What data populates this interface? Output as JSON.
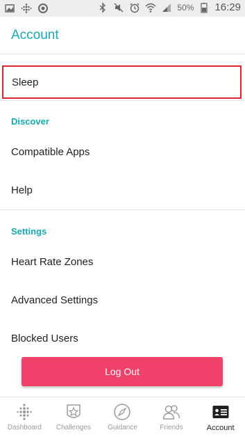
{
  "status_bar": {
    "battery_percent": "50%",
    "time": "16:29",
    "icons_left": [
      "image-icon",
      "fitbit-dots-icon",
      "sync-icon"
    ],
    "icons_right": [
      "bluetooth-icon",
      "mute-icon",
      "alarm-icon",
      "wifi-icon",
      "signal-icon",
      "battery-icon"
    ]
  },
  "header": {
    "title": "Account"
  },
  "list": {
    "sleep_label": "Sleep",
    "discover_heading": "Discover",
    "discover_items": [
      "Compatible Apps",
      "Help"
    ],
    "settings_heading": "Settings",
    "settings_items": [
      "Heart Rate Zones",
      "Advanced Settings",
      "Blocked Users"
    ]
  },
  "logout_label": "Log Out",
  "bottom_nav": {
    "active": "Account",
    "items": [
      {
        "label": "Dashboard",
        "icon": "dashboard-icon"
      },
      {
        "label": "Challenges",
        "icon": "challenges-icon"
      },
      {
        "label": "Guidance",
        "icon": "compass-icon"
      },
      {
        "label": "Friends",
        "icon": "friends-icon"
      },
      {
        "label": "Account",
        "icon": "account-card-icon"
      }
    ]
  },
  "colors": {
    "accent_teal": "#16a9b1",
    "logout_pink": "#ef4169",
    "highlight_red": "#d9252f"
  }
}
